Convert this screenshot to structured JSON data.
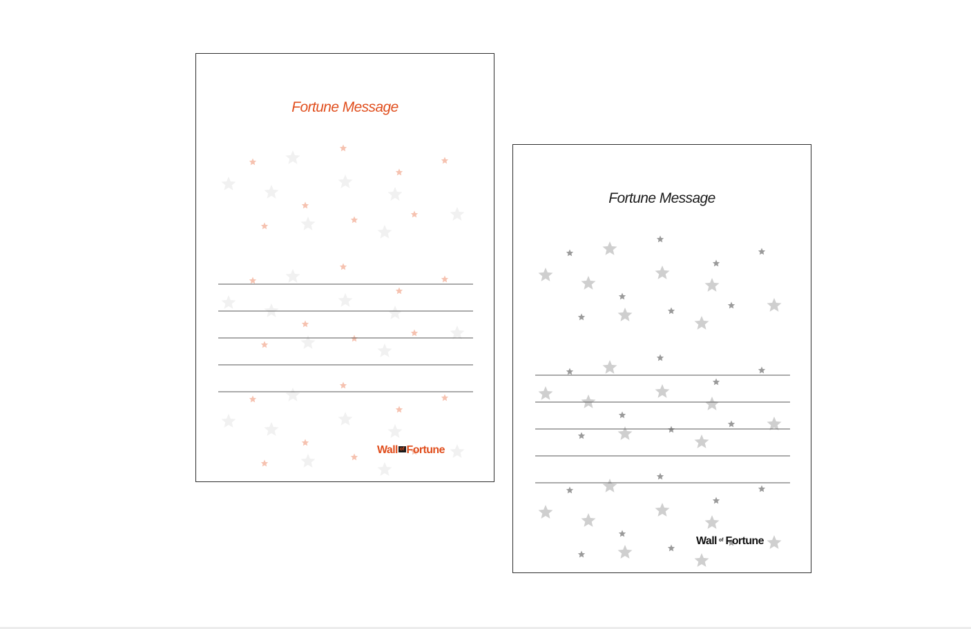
{
  "cards": [
    {
      "variant": "orange",
      "title": "Fortune Message",
      "logo": {
        "part1": "Wall",
        "part2": "of",
        "part3": "Fortune"
      },
      "colors": {
        "title": "#e04e1d",
        "small_star": "#f6c2b0",
        "big_star": "#f1f1f1",
        "line": "#555555"
      }
    },
    {
      "variant": "grey",
      "title": "Fortune Message",
      "logo": {
        "part1": "Wall",
        "part2": "of",
        "part3": "Fortune"
      },
      "colors": {
        "title": "#1a1a1a",
        "small_star": "#9a9a9a",
        "big_star": "#cfcfcf",
        "line": "#555555"
      }
    }
  ]
}
